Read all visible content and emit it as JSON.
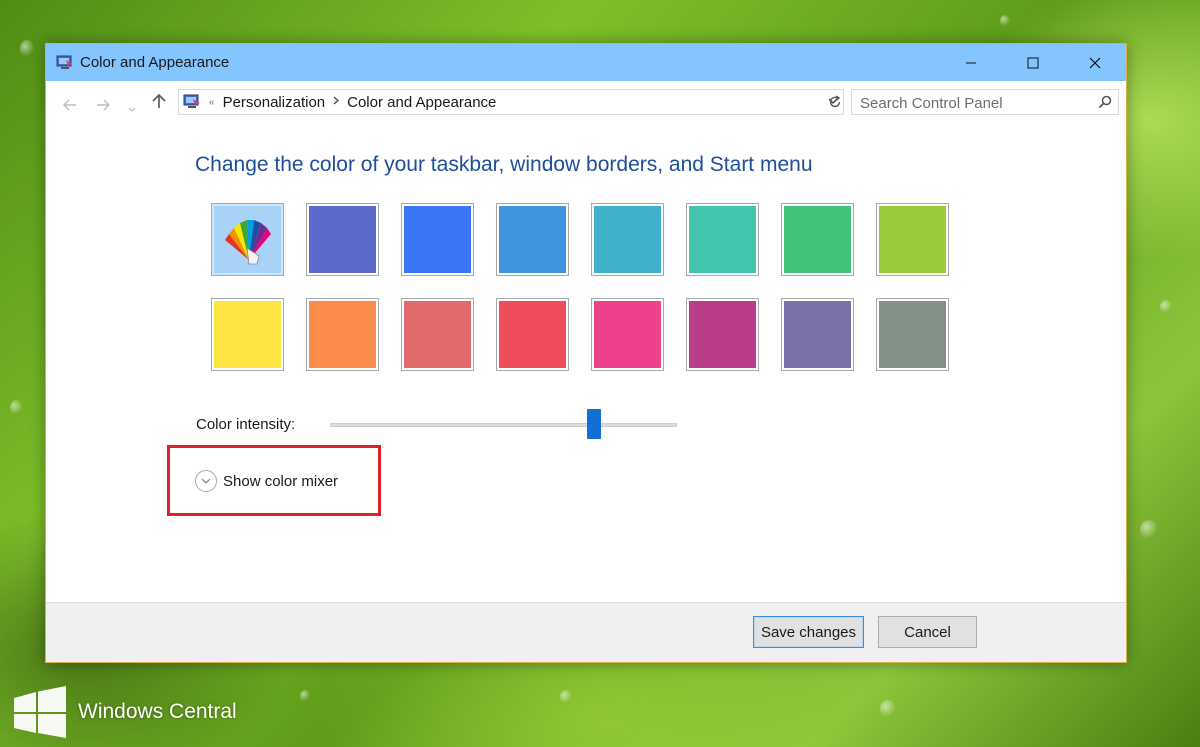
{
  "window": {
    "title": "Color and Appearance",
    "controls": {
      "minimize": "minimize-icon",
      "maximize": "maximize-icon",
      "close": "close-icon"
    }
  },
  "address_bar": {
    "breadcrumb": [
      "Personalization",
      "Color and Appearance"
    ],
    "separator_glyph": "«"
  },
  "search": {
    "placeholder": "Search Control Panel"
  },
  "main": {
    "heading": "Change the color of your taskbar, window borders, and Start menu",
    "swatches": [
      {
        "kind": "automatic",
        "icon": "color-palette-icon",
        "selected": true
      },
      {
        "color": "#5b6acb"
      },
      {
        "color": "#3b75f7"
      },
      {
        "color": "#4096de"
      },
      {
        "color": "#3fb1cb"
      },
      {
        "color": "#41c6ad"
      },
      {
        "color": "#40c27a"
      },
      {
        "color": "#9bcb3c"
      },
      {
        "color": "#fbe443"
      },
      {
        "color": "#fb8b4b"
      },
      {
        "color": "#e16a6c"
      },
      {
        "color": "#ef4d5c"
      },
      {
        "color": "#ed418b"
      },
      {
        "color": "#bb3c8a"
      },
      {
        "color": "#7d72a8"
      },
      {
        "color": "#849186"
      }
    ],
    "intensity_label": "Color intensity:",
    "intensity_value": 0.76,
    "mixer_label": "Show color mixer"
  },
  "footer": {
    "save_label": "Save changes",
    "cancel_label": "Cancel"
  },
  "watermark": "Windows Central",
  "colors": {
    "titlebar": "#84c4ff",
    "heading": "#1e4e9a",
    "accent": "#1170d6",
    "highlight": "#e0202a"
  }
}
